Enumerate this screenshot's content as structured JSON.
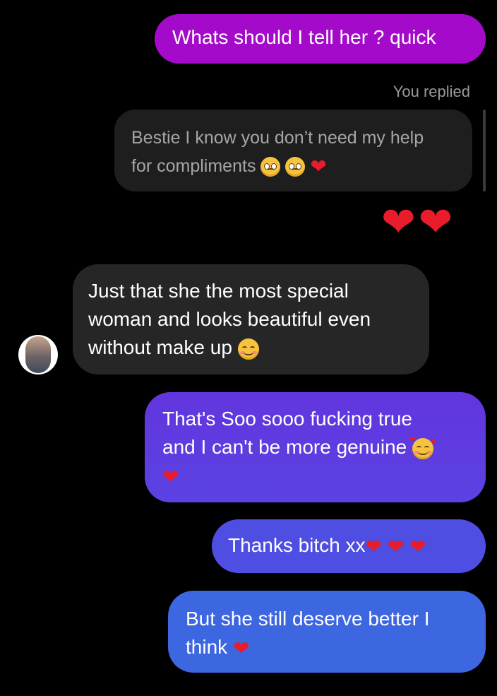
{
  "messages": {
    "sent_1": "Whats should I tell her ? quick",
    "replied_label": "You replied",
    "reply_quote_line_1": "Bestie I know you don’t need my help",
    "reply_quote_line_2": "for compliments",
    "received_line_1": "Just that she the most special",
    "received_line_2": "woman and looks beautiful even",
    "received_line_3": "without make up",
    "sent_2_line_1": "That's Soo sooo fucking true",
    "sent_2_line_2": "and I can't be more genuine",
    "sent_3": "Thanks bitch xx",
    "sent_4_line_1": "But she still deserve better I",
    "sent_4_line_2": "think"
  },
  "reactions": {
    "big_hearts": "❤❤"
  },
  "emoji": {
    "heart": "❤",
    "pleading_face": "pleading-face-icon",
    "smiling_face": "smiling-face-icon",
    "hearts_face": "smiling-face-with-hearts-icon"
  },
  "colors": {
    "background": "#000000",
    "sent_1": "#a40ac9",
    "reply_quote": "#1e1e1e",
    "received": "#262626",
    "sent_2": "#6235de",
    "sent_3": "#4e4ee3",
    "sent_4": "#3d66e1",
    "heart": "#e81c2b"
  }
}
